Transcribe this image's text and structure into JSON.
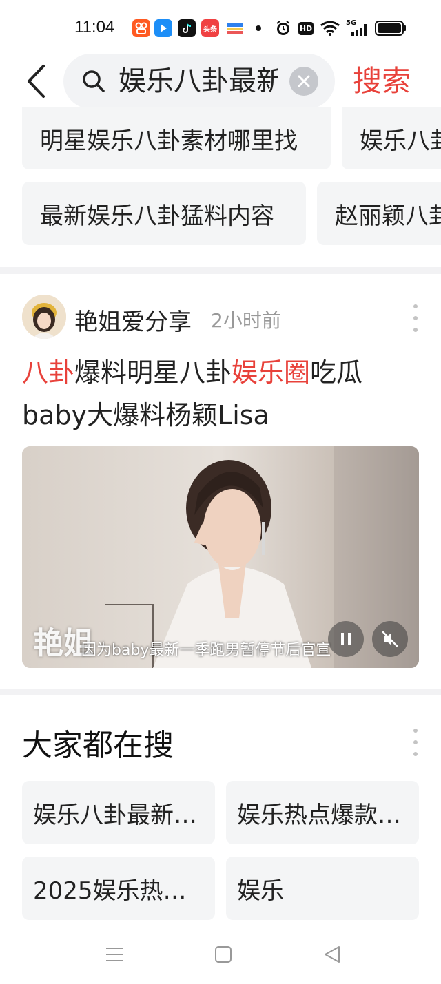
{
  "status_bar": {
    "time": "11:04",
    "app_icons": [
      "kuaishou-icon",
      "bilibili-icon",
      "tiktok-icon",
      "toutiao-icon",
      "wallet-icon"
    ],
    "toutiao_label": "头条",
    "network_label": "5G",
    "hd_label": "HD"
  },
  "header": {
    "search_value": "娱乐八卦最新",
    "search_button": "搜索"
  },
  "suggestions": {
    "row1": [
      "明星娱乐八卦素材哪里找",
      "娱乐八卦"
    ],
    "row2": [
      "最新娱乐八卦猛料内容",
      "赵丽颖八卦"
    ]
  },
  "post": {
    "author": "艳姐爱分享",
    "time": "2小时前",
    "title_parts": [
      {
        "text": "八卦",
        "highlight": true
      },
      {
        "text": "爆料明星八卦",
        "highlight": false
      },
      {
        "text": "娱乐圈",
        "highlight": true
      },
      {
        "text": "吃瓜baby大爆料杨颖Lisa",
        "highlight": false
      }
    ],
    "video": {
      "watermark": "艳姐",
      "subtitle": "因为baby最新一季跑男暂停节后官宣",
      "state": "playing",
      "muted": true
    }
  },
  "trending": {
    "title": "大家都在搜",
    "items": [
      "娱乐八卦最新…",
      "娱乐热点爆款…",
      "2025娱乐热…",
      "娱乐"
    ]
  },
  "colors": {
    "accent": "#e8413a",
    "chip_bg": "#f4f5f6",
    "muted_text": "#999999"
  }
}
